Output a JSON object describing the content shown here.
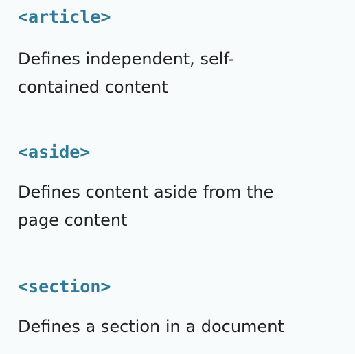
{
  "entries": [
    {
      "tag": "<article>",
      "description": "Defines independent, self-\ncontained content"
    },
    {
      "tag": "<aside>",
      "description": "Defines content aside from the\npage content"
    },
    {
      "tag": "<section>",
      "description": "Defines a section in a document"
    }
  ],
  "colors": {
    "tag": "#2f7a96",
    "text": "#222222",
    "background": "#f8fbfc"
  }
}
